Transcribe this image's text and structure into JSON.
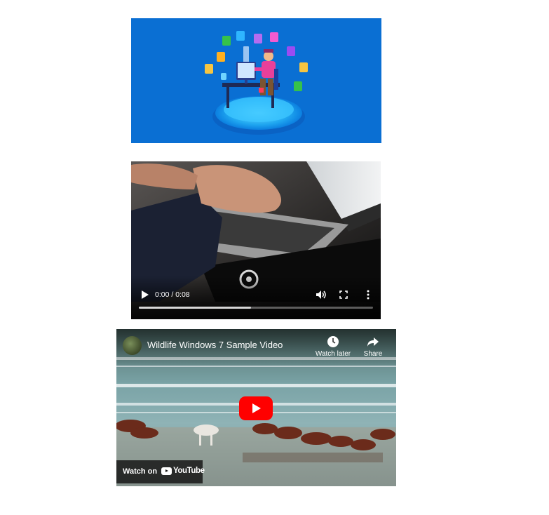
{
  "video": {
    "time_display": "0:00 / 0:08",
    "buffered_fraction": 0.48
  },
  "youtube": {
    "title": "Wildlife Windows 7 Sample Video",
    "watch_later_label": "Watch later",
    "share_label": "Share",
    "watch_on_label": "Watch on",
    "youtube_wordmark": "YouTube"
  },
  "colors": {
    "banner_background": "#0a6fd3",
    "youtube_red": "#ff0000"
  },
  "icons": {
    "video_play": "play-icon",
    "video_volume": "volume-icon",
    "video_fullscreen": "fullscreen-icon",
    "video_more": "more-vert-icon",
    "yt_watch_later": "clock-icon",
    "yt_share": "share-arrow-icon",
    "yt_play": "youtube-play-icon"
  }
}
